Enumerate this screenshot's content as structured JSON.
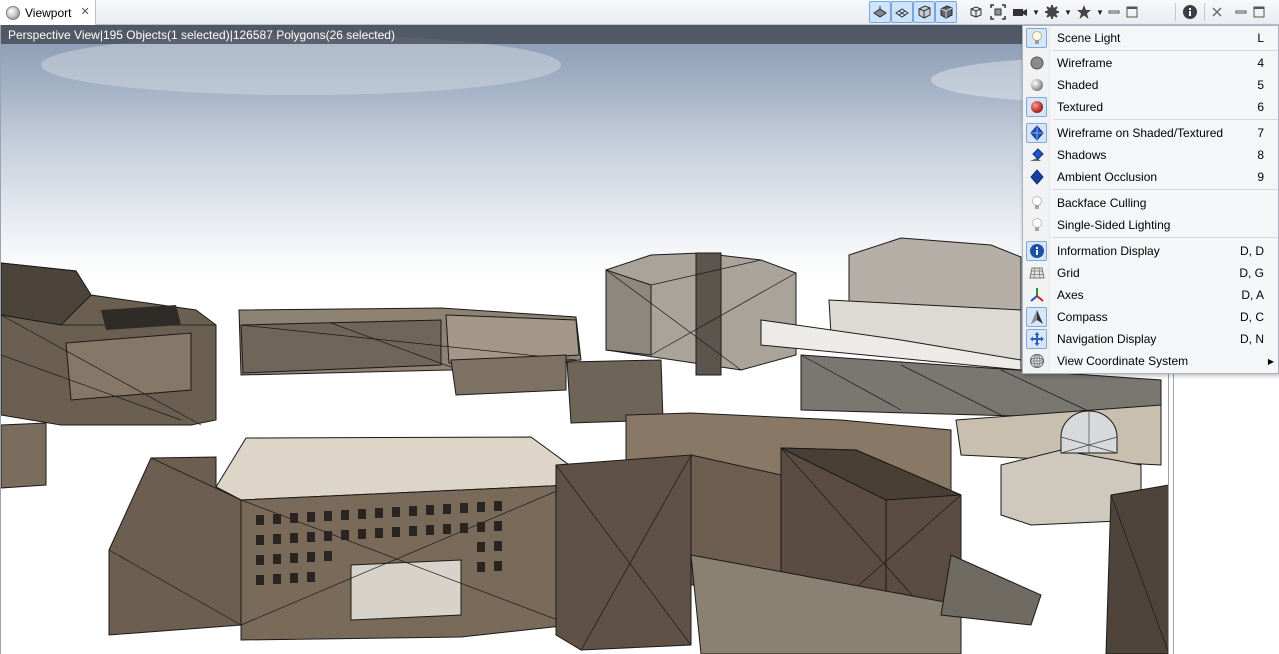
{
  "tab": {
    "title": "Viewport",
    "close_glyph": "✕"
  },
  "toolbar": {
    "view_mode_buttons": [
      {
        "icon": "solid-view-icon",
        "active": true
      },
      {
        "icon": "wire-view-icon",
        "active": true
      },
      {
        "icon": "box-view-icon",
        "active": true
      },
      {
        "icon": "textured-box-view-icon",
        "active": true
      }
    ],
    "tool_buttons": [
      {
        "icon": "cube-select-icon"
      },
      {
        "icon": "frame-selection-icon"
      },
      {
        "icon": "camera-icon",
        "dropdown": true
      },
      {
        "icon": "gear-icon",
        "dropdown": true
      },
      {
        "icon": "star-icon",
        "dropdown": true
      }
    ]
  },
  "info_bar": {
    "view": "Perspective View",
    "objects": "195 Objects",
    "objects_selected": "(1 selected)",
    "polygons": "126587 Polygons",
    "polygons_selected": "(26 selected)",
    "separator": "|"
  },
  "menu": {
    "items": [
      {
        "label": "Scene Light",
        "shortcut": "L",
        "icon": "bulb-icon",
        "checked": true
      },
      {
        "label": "Wireframe",
        "shortcut": "4",
        "icon": "gray-sphere-icon",
        "checked": false
      },
      {
        "label": "Shaded",
        "shortcut": "5",
        "icon": "shaded-sphere-icon",
        "checked": false
      },
      {
        "label": "Textured",
        "shortcut": "6",
        "icon": "textured-sphere-icon",
        "checked": true
      },
      {
        "label": "Wireframe on Shaded/Textured",
        "shortcut": "7",
        "icon": "wire-on-shaded-icon",
        "checked": true
      },
      {
        "label": "Shadows",
        "shortcut": "8",
        "icon": "shadows-icon",
        "checked": false
      },
      {
        "label": "Ambient Occlusion",
        "shortcut": "9",
        "icon": "ambient-occlusion-icon",
        "checked": false
      },
      {
        "label": "Backface Culling",
        "shortcut": "",
        "icon": "bulb-icon",
        "checked": false
      },
      {
        "label": "Single-Sided Lighting",
        "shortcut": "",
        "icon": "bulb-icon",
        "checked": false
      },
      {
        "label": "Information Display",
        "shortcut": "D, D",
        "icon": "info-icon",
        "checked": true
      },
      {
        "label": "Grid",
        "shortcut": "D, G",
        "icon": "grid-icon",
        "checked": false
      },
      {
        "label": "Axes",
        "shortcut": "D, A",
        "icon": "axes-icon",
        "checked": false
      },
      {
        "label": "Compass",
        "shortcut": "D, C",
        "icon": "compass-icon",
        "checked": true
      },
      {
        "label": "Navigation Display",
        "shortcut": "D, N",
        "icon": "navigation-icon",
        "checked": true
      },
      {
        "label": "View Coordinate System",
        "shortcut": "",
        "icon": "globe-grid-icon",
        "checked": false,
        "submenu_arrow": "▶"
      }
    ]
  },
  "colors": {
    "selection_blue": "#cfe3fa",
    "selection_border": "#76a6dd",
    "info_bar_bg": "#3c4048",
    "building_brown": "#6b5a4a"
  }
}
